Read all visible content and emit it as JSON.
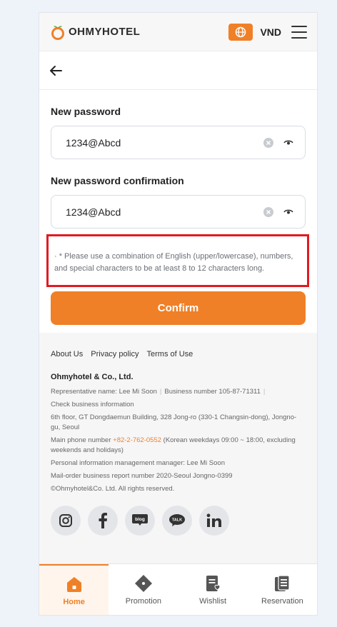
{
  "header": {
    "logo_text": "OHMYHOTEL",
    "currency": "VND"
  },
  "form": {
    "new_password_label": "New password",
    "new_password_value": "1234@Abcd",
    "confirm_label": "New password confirmation",
    "confirm_value": "1234@Abcd",
    "hint": "· * Please use a combination of English (upper/lowercase), numbers, and special characters to be at least 8 to 12 characters long.",
    "confirm_button": "Confirm"
  },
  "footer": {
    "links": [
      "About Us",
      "Privacy policy",
      "Terms of Use"
    ],
    "company": "Ohmyhotel & Co., Ltd.",
    "representative": "Representative name: Lee Mi Soon",
    "business_number": "Business number 105-87-71311",
    "check_business": "Check business information",
    "address": "6th floor, GT Dongdaemun Building, 328 Jong-ro (330-1 Changsin-dong), Jongno-gu, Seoul",
    "main_phone_label": "Main phone number",
    "main_phone": "+82-2-762-0552",
    "phone_hours": "(Korean weekdays 09:00 ~ 18:00, excluding weekends and holidays)",
    "privacy_manager": "Personal information management manager: Lee Mi Soon",
    "mail_order": "Mail-order business report number 2020-Seoul Jongno-0399",
    "copyright": "©Ohmyhotel&Co. Ltd. All rights reserved.",
    "socials": [
      "instagram-icon",
      "facebook-icon",
      "blog-icon",
      "talk-icon",
      "linkedin-icon"
    ],
    "blog_text": "blog",
    "talk_text": "TALK"
  },
  "nav": {
    "items": [
      {
        "label": "Home",
        "icon": "home-icon"
      },
      {
        "label": "Promotion",
        "icon": "promotion-icon"
      },
      {
        "label": "Wishlist",
        "icon": "wishlist-icon"
      },
      {
        "label": "Reservation",
        "icon": "reservation-icon"
      }
    ]
  },
  "colors": {
    "accent": "#f08027",
    "highlight_border": "#e11a22"
  }
}
